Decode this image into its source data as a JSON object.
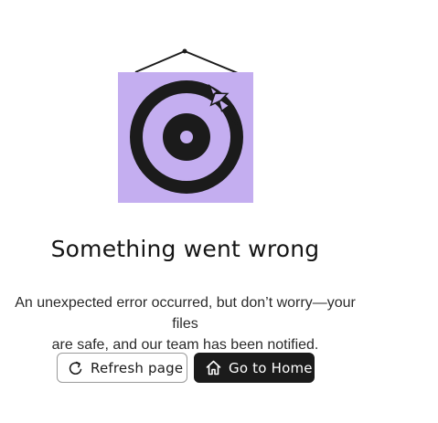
{
  "error_page": {
    "title": "Something went wrong",
    "message_line1": "An unexpected error occurred, but don’t worry—your files",
    "message_line2": "are safe, and our team has been notified.",
    "illustration": {
      "icon": "dartboard-icon",
      "poster_color": "#c4aef0",
      "ring_color": "#1b1b1b"
    }
  },
  "actions": {
    "refresh_label": "Refresh page",
    "refresh_icon": "refresh-icon",
    "home_label": "Go to Home",
    "home_icon": "home-icon"
  }
}
